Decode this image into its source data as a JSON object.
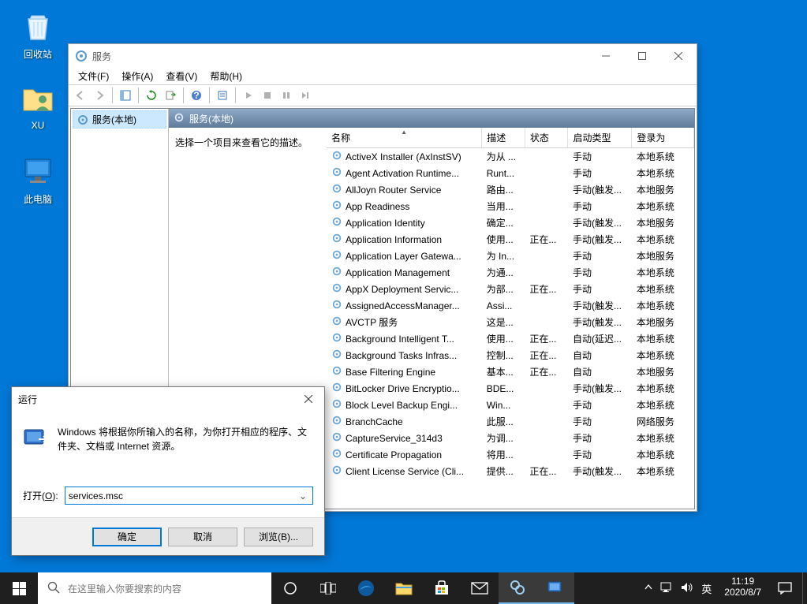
{
  "desktop": {
    "recycle_bin": "回收站",
    "user_folder": "XU",
    "this_pc": "此电脑"
  },
  "services_window": {
    "title": "服务",
    "menu": {
      "file": "文件(F)",
      "action": "操作(A)",
      "view": "查看(V)",
      "help": "帮助(H)"
    },
    "tree_root": "服务(本地)",
    "pane_header": "服务(本地)",
    "desc_hint": "选择一个项目来查看它的描述。",
    "columns": {
      "name": "名称",
      "desc": "描述",
      "status": "状态",
      "startup": "启动类型",
      "logon": "登录为"
    },
    "rows": [
      {
        "name": "ActiveX Installer (AxInstSV)",
        "desc": "为从 ...",
        "status": "",
        "startup": "手动",
        "logon": "本地系统"
      },
      {
        "name": "Agent Activation Runtime...",
        "desc": "Runt...",
        "status": "",
        "startup": "手动",
        "logon": "本地系统"
      },
      {
        "name": "AllJoyn Router Service",
        "desc": "路由...",
        "status": "",
        "startup": "手动(触发...",
        "logon": "本地服务"
      },
      {
        "name": "App Readiness",
        "desc": "当用...",
        "status": "",
        "startup": "手动",
        "logon": "本地系统"
      },
      {
        "name": "Application Identity",
        "desc": "确定...",
        "status": "",
        "startup": "手动(触发...",
        "logon": "本地服务"
      },
      {
        "name": "Application Information",
        "desc": "使用...",
        "status": "正在...",
        "startup": "手动(触发...",
        "logon": "本地系统"
      },
      {
        "name": "Application Layer Gatewa...",
        "desc": "为 In...",
        "status": "",
        "startup": "手动",
        "logon": "本地服务"
      },
      {
        "name": "Application Management",
        "desc": "为通...",
        "status": "",
        "startup": "手动",
        "logon": "本地系统"
      },
      {
        "name": "AppX Deployment Servic...",
        "desc": "为部...",
        "status": "正在...",
        "startup": "手动",
        "logon": "本地系统"
      },
      {
        "name": "AssignedAccessManager...",
        "desc": "Assi...",
        "status": "",
        "startup": "手动(触发...",
        "logon": "本地系统"
      },
      {
        "name": "AVCTP 服务",
        "desc": "这是...",
        "status": "",
        "startup": "手动(触发...",
        "logon": "本地服务"
      },
      {
        "name": "Background Intelligent T...",
        "desc": "使用...",
        "status": "正在...",
        "startup": "自动(延迟...",
        "logon": "本地系统"
      },
      {
        "name": "Background Tasks Infras...",
        "desc": "控制...",
        "status": "正在...",
        "startup": "自动",
        "logon": "本地系统"
      },
      {
        "name": "Base Filtering Engine",
        "desc": "基本...",
        "status": "正在...",
        "startup": "自动",
        "logon": "本地服务"
      },
      {
        "name": "BitLocker Drive Encryptio...",
        "desc": "BDE...",
        "status": "",
        "startup": "手动(触发...",
        "logon": "本地系统"
      },
      {
        "name": "Block Level Backup Engi...",
        "desc": "Win...",
        "status": "",
        "startup": "手动",
        "logon": "本地系统"
      },
      {
        "name": "BranchCache",
        "desc": "此服...",
        "status": "",
        "startup": "手动",
        "logon": "网络服务"
      },
      {
        "name": "CaptureService_314d3",
        "desc": "为调...",
        "status": "",
        "startup": "手动",
        "logon": "本地系统"
      },
      {
        "name": "Certificate Propagation",
        "desc": "将用...",
        "status": "",
        "startup": "手动",
        "logon": "本地系统"
      },
      {
        "name": "Client License Service (Cli...",
        "desc": "提供...",
        "status": "正在...",
        "startup": "手动(触发...",
        "logon": "本地系统"
      }
    ]
  },
  "run_dialog": {
    "title": "运行",
    "hint": "Windows 将根据你所输入的名称，为你打开相应的程序、文件夹、文档或 Internet 资源。",
    "open_label_pre": "打开(",
    "open_label_u": "O",
    "open_label_post": "):",
    "value": "services.msc",
    "ok": "确定",
    "cancel": "取消",
    "browse": "浏览(B)..."
  },
  "taskbar": {
    "search_placeholder": "在这里输入你要搜索的内容",
    "ime": "英",
    "time": "11:19",
    "date": "2020/8/7"
  }
}
